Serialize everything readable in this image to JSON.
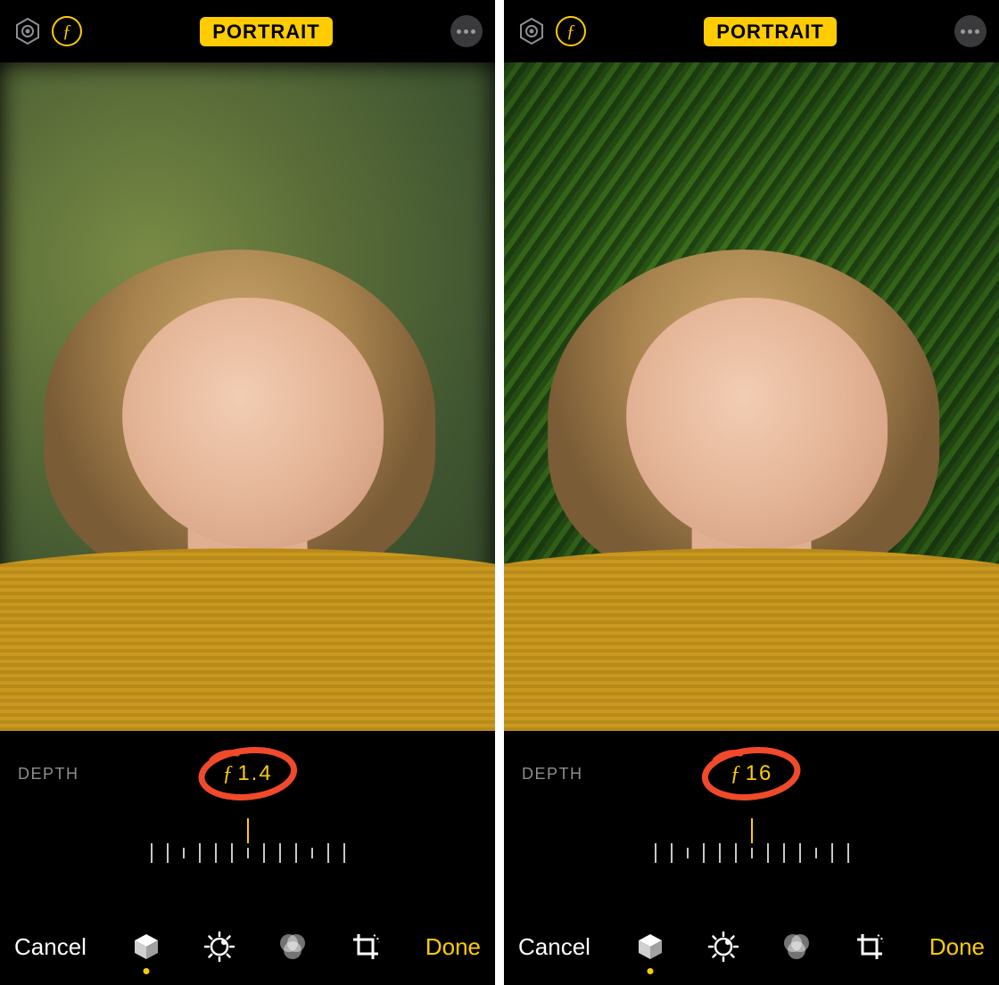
{
  "panes": [
    {
      "mode_label": "PORTRAIT",
      "depth_label": "DEPTH",
      "f_prefix": "ƒ",
      "f_value": "1.4",
      "cancel_label": "Cancel",
      "done_label": "Done",
      "blurred_background": true,
      "slider": {
        "tick_pattern": "RTSTTTSTTTSTT"
      }
    },
    {
      "mode_label": "PORTRAIT",
      "depth_label": "DEPTH",
      "f_prefix": "ƒ",
      "f_value": "16",
      "cancel_label": "Cancel",
      "done_label": "Done",
      "blurred_background": false,
      "slider": {
        "tick_pattern": "TTSTTTSTTTSTR"
      }
    }
  ],
  "icons": {
    "hex": "portrait-lighting-icon",
    "f": "aperture-f-icon",
    "more": "more-icon",
    "lighting": "lighting-cube-icon",
    "adjust": "adjust-dial-icon",
    "filters": "filters-circles-icon",
    "crop": "crop-rotate-icon"
  },
  "annotation_color": "#f04a2a",
  "accent_color": "#ffcc00"
}
